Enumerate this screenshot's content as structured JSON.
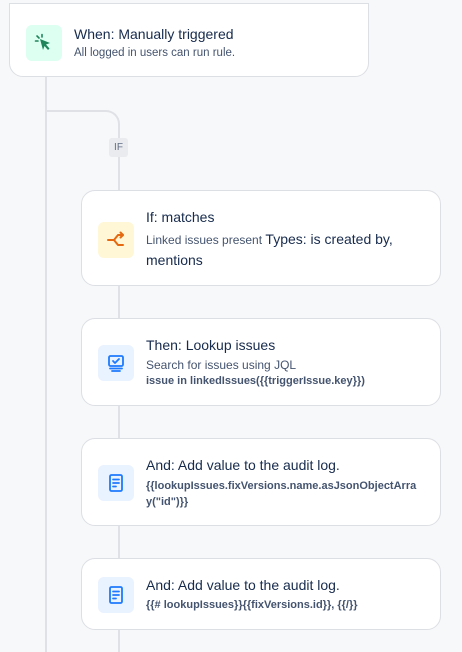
{
  "trigger": {
    "title": "When: Manually triggered",
    "subtitle": "All logged in users can run rule.",
    "icon": "cursor-click-icon",
    "icon_bg": "#dcfff1",
    "icon_color": "#1f845a"
  },
  "branch": {
    "label": "IF"
  },
  "steps": [
    {
      "title": "If: matches",
      "subtitle_prefix": "Linked issues present",
      "subtitle_value": "Types: is created by, mentions",
      "icon": "branch-condition-icon",
      "icon_bg": "#fff7d6",
      "icon_color": "#e56910"
    },
    {
      "title": "Then: Lookup issues",
      "subtitle": "Search for issues using JQL",
      "code": "issue in linkedIssues({{triggerIssue.key}})",
      "icon": "lookup-screen-icon",
      "icon_bg": "#e9f2ff",
      "icon_color": "#1d7afc"
    },
    {
      "title": "And: Add value to the audit log.",
      "code": "{{lookupIssues.fixVersions.name.asJsonObjectArray(\"id\")}}",
      "icon": "document-icon",
      "icon_bg": "#e9f2ff",
      "icon_color": "#1d7afc"
    },
    {
      "title": "And: Add value to the audit log.",
      "code": "{{# lookupIssues}}{{fixVersions.id}}, {{/}}",
      "icon": "document-icon",
      "icon_bg": "#e9f2ff",
      "icon_color": "#1d7afc"
    }
  ]
}
